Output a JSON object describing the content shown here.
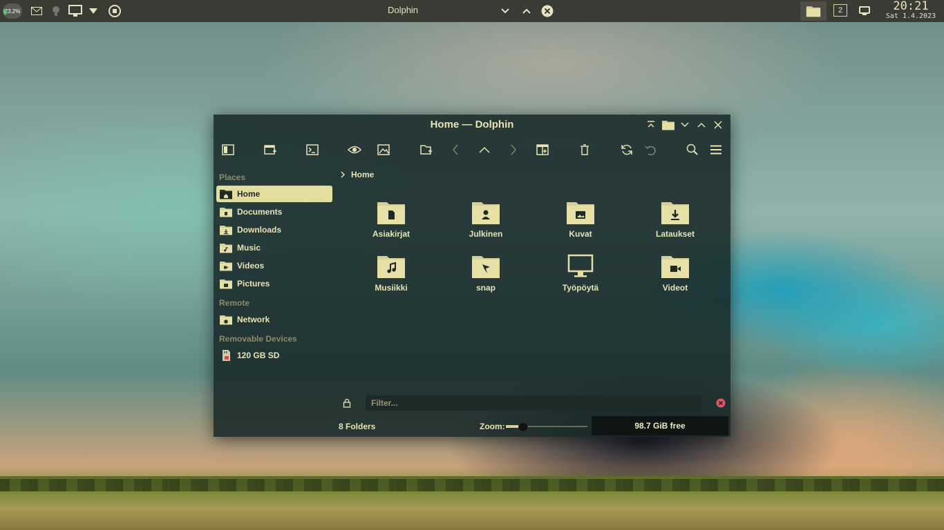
{
  "panel": {
    "battery": "23.2%",
    "task_title": "Dolphin",
    "pager_number": "2",
    "clock_time": "20:21",
    "clock_date": "Sat 1.4.2023"
  },
  "window": {
    "title": "Home — Dolphin"
  },
  "sidebar": {
    "places_header": "Places",
    "places": [
      {
        "label": "Home",
        "icon": "home-folder-icon"
      },
      {
        "label": "Documents",
        "icon": "documents-folder-icon"
      },
      {
        "label": "Downloads",
        "icon": "downloads-folder-icon"
      },
      {
        "label": "Music",
        "icon": "music-folder-icon"
      },
      {
        "label": "Videos",
        "icon": "videos-folder-icon"
      },
      {
        "label": "Pictures",
        "icon": "pictures-folder-icon"
      }
    ],
    "remote_header": "Remote",
    "remote": [
      {
        "label": "Network",
        "icon": "network-folder-icon"
      }
    ],
    "removable_header": "Removable Devices",
    "removable": [
      {
        "label": "120 GB SD",
        "icon": "sd-card-icon"
      }
    ]
  },
  "breadcrumb": {
    "current": "Home"
  },
  "folders": [
    {
      "label": "Asiakirjat",
      "icon": "document-folder-icon"
    },
    {
      "label": "Julkinen",
      "icon": "public-folder-icon"
    },
    {
      "label": "Kuvat",
      "icon": "image-folder-icon"
    },
    {
      "label": "Lataukset",
      "icon": "download-folder-icon"
    },
    {
      "label": "Musiikki",
      "icon": "music-folder-icon"
    },
    {
      "label": "snap",
      "icon": "snap-folder-icon"
    },
    {
      "label": "Työpöytä",
      "icon": "desktop-icon"
    },
    {
      "label": "Videot",
      "icon": "video-folder-icon"
    }
  ],
  "filter": {
    "placeholder": "Filter..."
  },
  "status": {
    "count": "8 Folders",
    "zoom_label": "Zoom:",
    "zoom_level": 0.2,
    "free_space": "98.7 GiB free"
  },
  "colors": {
    "accent": "#e3dd9f",
    "window_bg": "#16262680",
    "panel_bg": "#3b3b35",
    "close_red": "#e0566a"
  }
}
